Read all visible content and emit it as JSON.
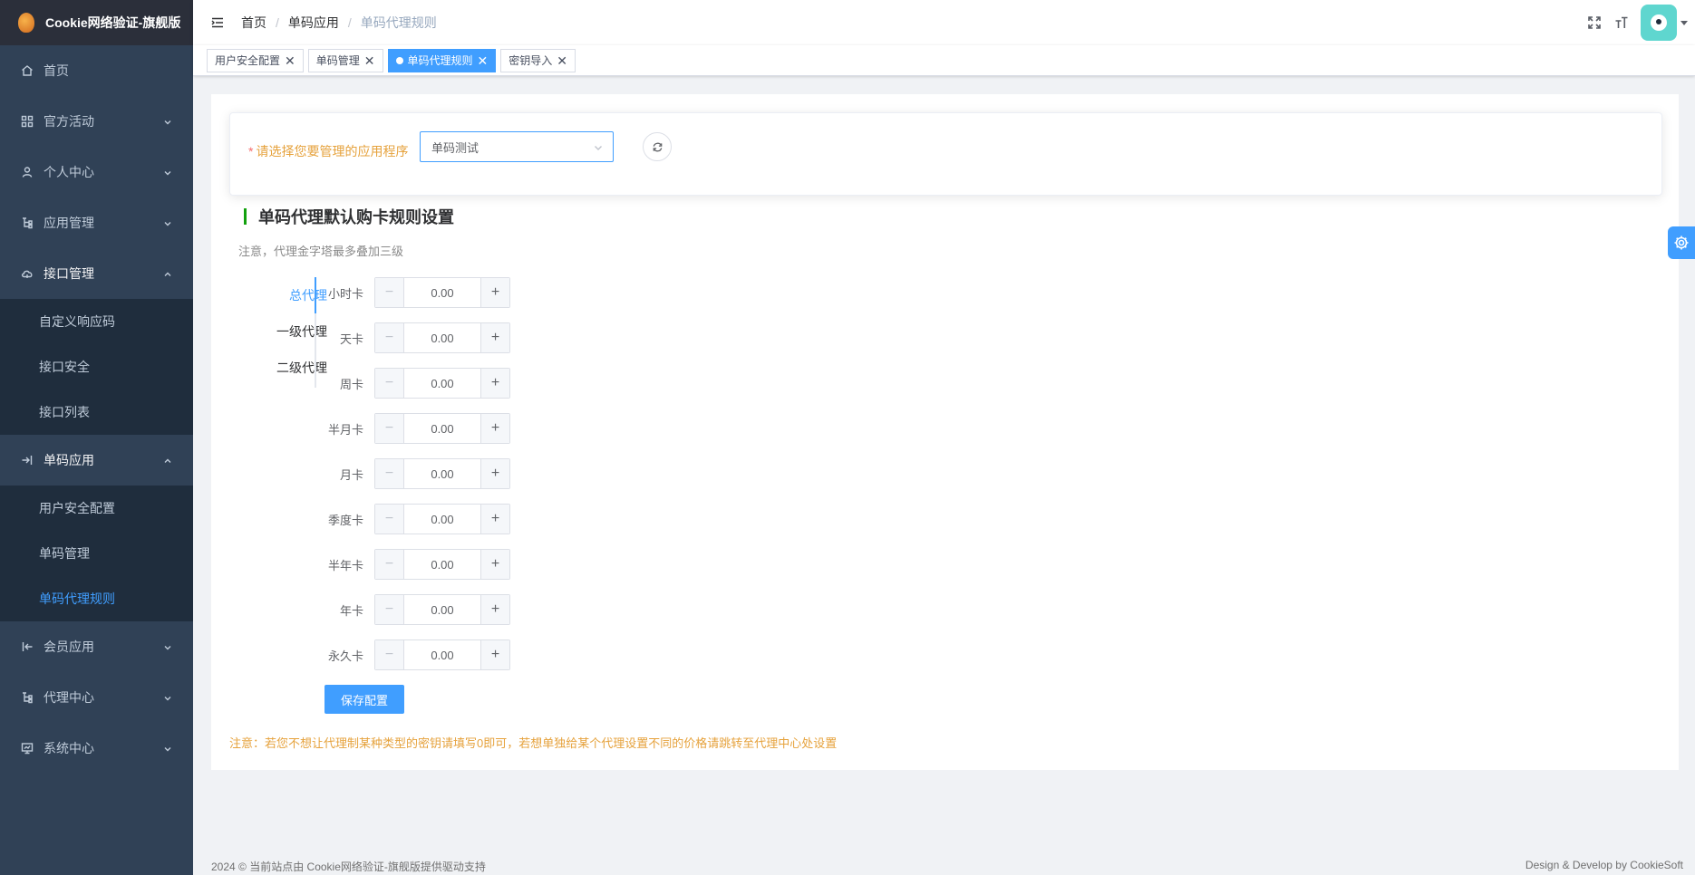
{
  "app": {
    "title": "Cookie网络验证-旗舰版"
  },
  "sidebar": {
    "items": [
      {
        "label": "首页",
        "icon": "home-icon"
      },
      {
        "label": "官方活动",
        "icon": "grid-icon"
      },
      {
        "label": "个人中心",
        "icon": "user-icon"
      },
      {
        "label": "应用管理",
        "icon": "tree-icon"
      },
      {
        "label": "接口管理",
        "icon": "cloud-icon"
      },
      {
        "label": "单码应用",
        "icon": "login-icon"
      },
      {
        "label": "会员应用",
        "icon": "logout-icon"
      },
      {
        "label": "代理中心",
        "icon": "tree-icon"
      },
      {
        "label": "系统中心",
        "icon": "monitor-icon"
      }
    ],
    "api_sub": [
      "自定义响应码",
      "接口安全",
      "接口列表"
    ],
    "single_sub": [
      "用户安全配置",
      "单码管理",
      "单码代理规则"
    ]
  },
  "breadcrumb": [
    "首页",
    "单码应用",
    "单码代理规则"
  ],
  "tags": [
    "用户安全配置",
    "单码管理",
    "单码代理规则",
    "密钥导入"
  ],
  "form": {
    "label": "请选择您要管理的应用程序",
    "required_mark": "*",
    "selected_app": "单码测试"
  },
  "section": {
    "title": "单码代理默认购卡规则设置",
    "note": "注意，代理金字塔最多叠加三级"
  },
  "agent_tabs": [
    "总代理",
    "一级代理",
    "二级代理"
  ],
  "active_agent_tab": "总代理",
  "rules": [
    {
      "label": "小时卡",
      "value": "0.00"
    },
    {
      "label": "天卡",
      "value": "0.00"
    },
    {
      "label": "周卡",
      "value": "0.00"
    },
    {
      "label": "半月卡",
      "value": "0.00"
    },
    {
      "label": "月卡",
      "value": "0.00"
    },
    {
      "label": "季度卡",
      "value": "0.00"
    },
    {
      "label": "半年卡",
      "value": "0.00"
    },
    {
      "label": "年卡",
      "value": "0.00"
    },
    {
      "label": "永久卡",
      "value": "0.00"
    }
  ],
  "save_label": "保存配置",
  "bottom_note": "注意：若您不想让代理制某种类型的密钥请填写0即可，若想单独给某个代理设置不同的价格请跳转至代理中心处设置",
  "footer": {
    "left": "2024 © 当前站点由 Cookie网络验证-旗舰版提供驱动支持",
    "right": "Design & Develop by CookieSoft"
  },
  "colors": {
    "accent": "#409eff",
    "sidebar": "#304156",
    "warning": "#e6a23c",
    "section_bar": "#13a10e"
  }
}
